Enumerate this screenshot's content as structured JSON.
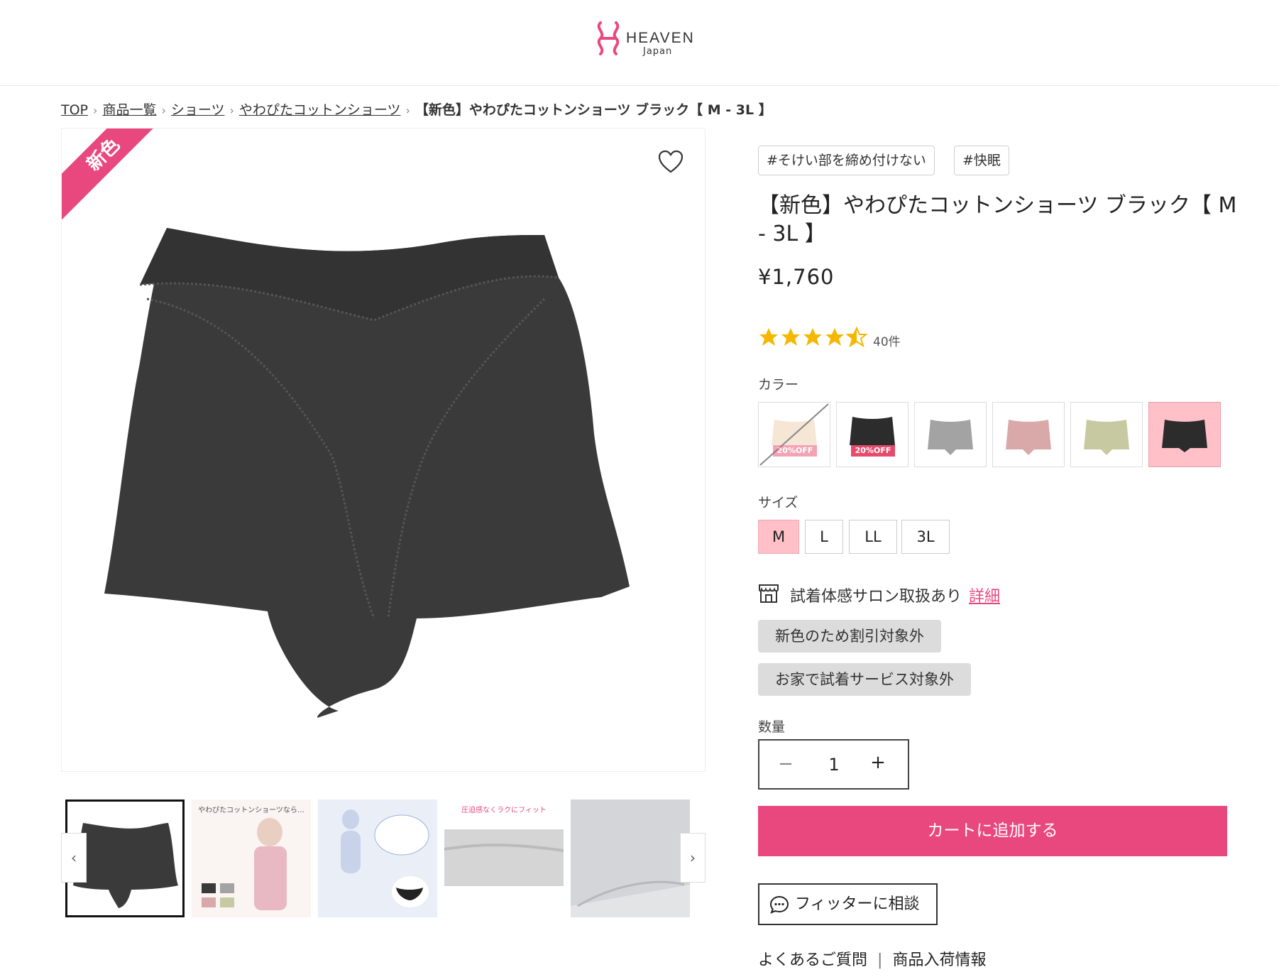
{
  "header": {
    "logo_text": "HEAVEN",
    "logo_sub": "Japan",
    "brand_color": "#e9487f"
  },
  "breadcrumb": {
    "items": [
      "TOP",
      "商品一覧",
      "ショーツ",
      "やわぴたコットンショーツ"
    ],
    "current": "【新色】やわぴたコットンショーツ ブラック【 M - 3L 】",
    "separator": "›"
  },
  "gallery": {
    "ribbon": "新色",
    "favorite_icon": "heart-icon",
    "product_color": "#3a3a3a",
    "prev_icon": "‹",
    "next_icon": "›",
    "thumbs": [
      {
        "caption": ""
      },
      {
        "caption": "やわぴたコットンショーツなら…"
      },
      {
        "caption": ""
      },
      {
        "caption": "圧迫感なくラクにフィット"
      },
      {
        "caption": ""
      }
    ]
  },
  "product": {
    "tags": [
      "#そけい部を締め付けない",
      "#快眠"
    ],
    "title": "【新色】やわぴたコットンショーツ ブラック【 M - 3L 】",
    "price": "¥1,760",
    "rating": 4.5,
    "review_count": "40件",
    "star_color": "#f5b800"
  },
  "color": {
    "label": "カラー",
    "swatches": [
      {
        "name": "cream",
        "color": "#f5e6d6",
        "badge": "20%OFF",
        "sold_out": true
      },
      {
        "name": "black",
        "color": "#2c2c2c",
        "badge": "20%OFF",
        "sold_out": false
      },
      {
        "name": "gray",
        "color": "#a3a3a3",
        "badge": "",
        "sold_out": false
      },
      {
        "name": "pink",
        "color": "#d9a9a9",
        "badge": "",
        "sold_out": false
      },
      {
        "name": "khaki",
        "color": "#c7c9a1",
        "badge": "",
        "sold_out": false
      },
      {
        "name": "black-selected",
        "color": "#2c2c2c",
        "badge": "",
        "sold_out": false
      }
    ]
  },
  "size": {
    "label": "サイズ",
    "options": [
      "M",
      "L",
      "LL",
      "3L"
    ],
    "selected": "M"
  },
  "salon": {
    "text": "試着体感サロン取扱あり",
    "link": "詳細"
  },
  "notices": [
    "新色のため割引対象外",
    "お家で試着サービス対象外"
  ],
  "quantity": {
    "label": "数量",
    "minus": "−",
    "value": "1",
    "plus": "+"
  },
  "actions": {
    "cart": "カートに追加する",
    "fitter": "フィッターに相談"
  },
  "footer": {
    "links": [
      "よくあるご質問",
      "商品入荷情報"
    ],
    "divider": "|"
  }
}
